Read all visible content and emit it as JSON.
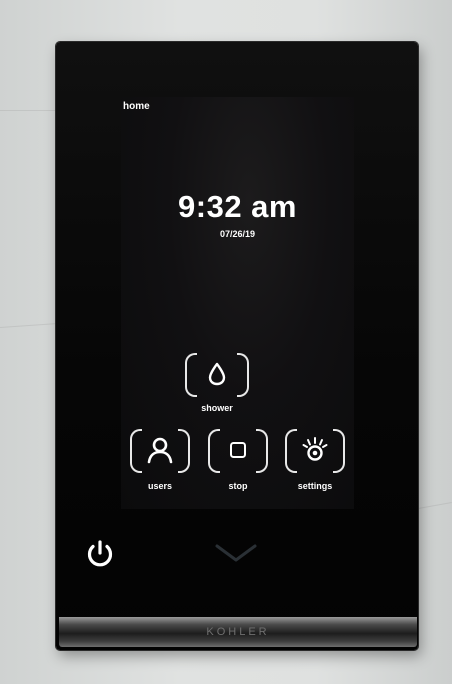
{
  "screen": {
    "title": "home",
    "time": "9:32 am",
    "date": "07/26/19"
  },
  "controls": {
    "shower": {
      "label": "shower",
      "icon": "water-drop-icon"
    },
    "users": {
      "label": "users",
      "icon": "user-icon"
    },
    "stop": {
      "label": "stop",
      "icon": "stop-icon"
    },
    "settings": {
      "label": "settings",
      "icon": "settings-icon"
    }
  },
  "hardware": {
    "power_icon": "power-icon",
    "expand_icon": "chevron-down-icon",
    "brand": "KOHLER"
  },
  "colors": {
    "foreground": "#ffffff",
    "bezel": "#0a0a0a",
    "screen": "#111012"
  }
}
